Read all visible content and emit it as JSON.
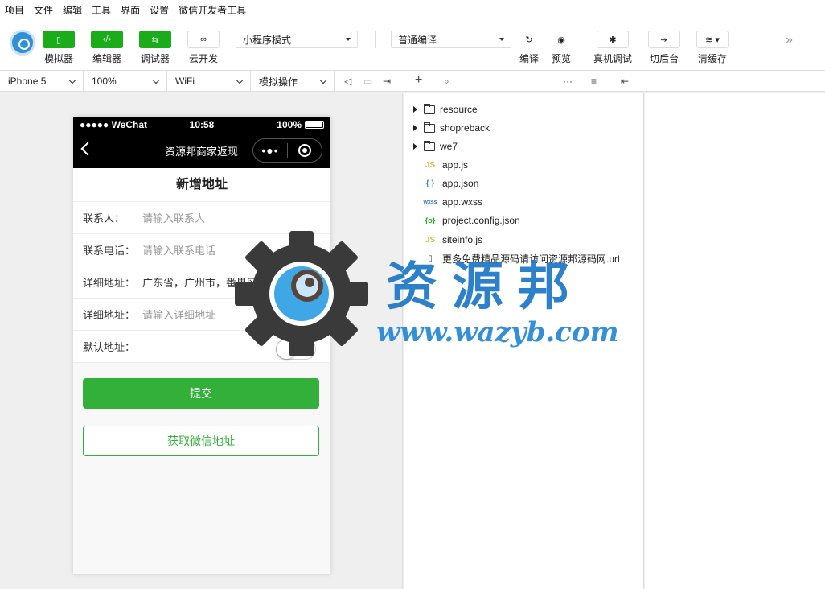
{
  "menu": [
    "项目",
    "文件",
    "编辑",
    "工具",
    "界面",
    "设置",
    "微信开发者工具"
  ],
  "toolbar": {
    "simulator_label": "模拟器",
    "editor_label": "编辑器",
    "debugger_label": "调试器",
    "cloud_label": "云开发",
    "mode_select": "小程序模式",
    "compile_select": "普通编译",
    "compile_label": "编译",
    "preview_label": "预览",
    "remote_debug_label": "真机调试",
    "background_label": "切后台",
    "clear_cache_label": "清缓存"
  },
  "subbar": {
    "device": "iPhone 5",
    "zoom": "100%",
    "network": "WiFi",
    "operation": "模拟操作"
  },
  "phone": {
    "carrier": "●●●●● WeChat",
    "time": "10:58",
    "battery": "100%",
    "nav_title": "资源邦商家返现",
    "capsule_dots": "•●•",
    "page_title": "新增地址",
    "rows": [
      {
        "label": "联系人：",
        "value": "请输入联系人",
        "placeholder": true
      },
      {
        "label": "联系电话：",
        "value": "请输入联系电话",
        "placeholder": true
      },
      {
        "label": "详细地址：",
        "value": "广东省，广州市，番禺区",
        "placeholder": false
      },
      {
        "label": "详细地址：",
        "value": "请输入详细地址",
        "placeholder": true
      },
      {
        "label": "默认地址：",
        "value": "",
        "placeholder": false
      }
    ],
    "submit_label": "提交",
    "wechat_address_label": "获取微信地址"
  },
  "tree": {
    "folders": [
      "resource",
      "shopreback",
      "we7"
    ],
    "files": [
      {
        "icon": "JS",
        "name": "app.js",
        "kind": "js"
      },
      {
        "icon": "{ }",
        "name": "app.json",
        "kind": "json"
      },
      {
        "icon": "wxss",
        "name": "app.wxss",
        "kind": "wxss"
      },
      {
        "icon": "{o}",
        "name": "project.config.json",
        "kind": "conf"
      },
      {
        "icon": "JS",
        "name": "siteinfo.js",
        "kind": "js"
      },
      {
        "icon": "▯",
        "name": "更多免费精品源码请访问资源邦源码网.url",
        "kind": "url"
      }
    ]
  },
  "watermark": {
    "cn": "资源邦",
    "url": "www.wazyb.com"
  },
  "colors": {
    "accent_green": "#1aad19",
    "watermark_blue": "#1b77c6"
  }
}
